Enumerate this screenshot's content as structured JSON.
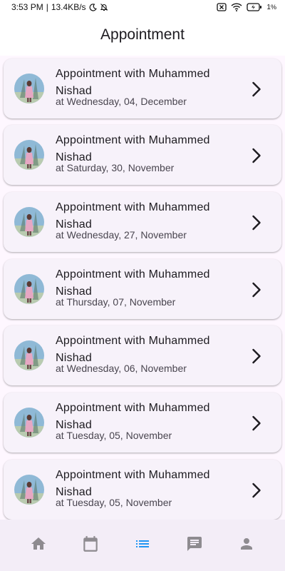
{
  "status_bar": {
    "time": "3:53 PM",
    "speed": "13.4KB/s",
    "battery_percent": "1",
    "battery_unit": "%"
  },
  "header": {
    "title": "Appointment"
  },
  "appointments": [
    {
      "title": "Appointment with Muhammed Nishad",
      "date": "at Wednesday, 04, December"
    },
    {
      "title": "Appointment with Muhammed Nishad",
      "date": "at Saturday, 30, November"
    },
    {
      "title": "Appointment with Muhammed Nishad",
      "date": "at Wednesday, 27, November"
    },
    {
      "title": "Appointment with Muhammed Nishad",
      "date": "at Thursday, 07, November"
    },
    {
      "title": "Appointment with Muhammed Nishad",
      "date": "at Wednesday, 06, November"
    },
    {
      "title": "Appointment with Muhammed Nishad",
      "date": "at Tuesday, 05, November"
    },
    {
      "title": "Appointment with Muhammed Nishad",
      "date": "at Tuesday, 05, November"
    }
  ],
  "bottom_nav": {
    "items": [
      {
        "icon": "home-icon",
        "active": false
      },
      {
        "icon": "calendar-icon",
        "active": false
      },
      {
        "icon": "list-icon",
        "active": true
      },
      {
        "icon": "chat-icon",
        "active": false
      },
      {
        "icon": "person-icon",
        "active": false
      }
    ]
  },
  "colors": {
    "background": "#FEF7FF",
    "card": "#F7F2FA",
    "nav_background": "#F3EDF7",
    "nav_active": "#2196F3",
    "nav_inactive": "#8E8B90"
  }
}
